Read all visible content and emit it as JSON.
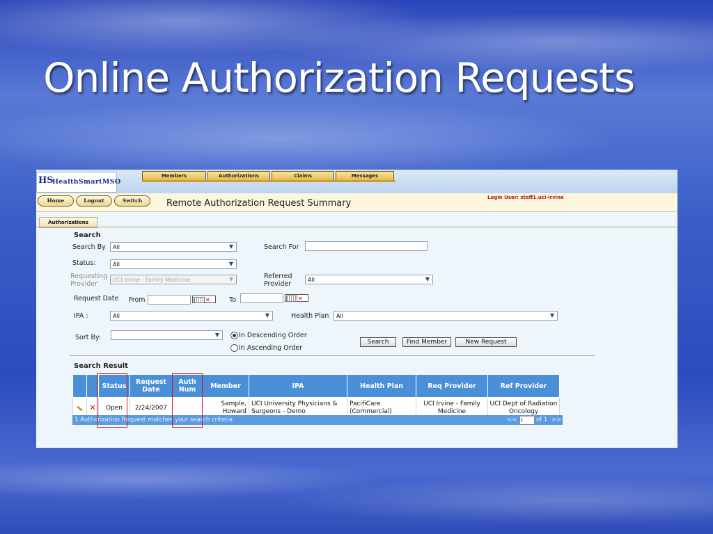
{
  "slide": {
    "title": "Online Authorization Requests"
  },
  "app": {
    "logo_mark": "HS",
    "logo_text": "HealthSmartMSO",
    "nav_tabs": [
      "Members",
      "Authorizations",
      "Claims",
      "Messages"
    ],
    "actions": {
      "home": "Home",
      "logout": "Logout",
      "switch": "Switch"
    },
    "page_title": "Remote Authorization Request Summary",
    "login_user": "Login User: staff1.uci-irvine",
    "subtab": "Authorizations"
  },
  "search": {
    "heading": "Search",
    "search_by_label": "Search By",
    "search_by_value": "All",
    "search_for_label": "Search For",
    "search_for_value": "",
    "status_label": "Status:",
    "status_value": "All",
    "requesting_provider_label_1": "Requesting",
    "requesting_provider_label_2": "Provider",
    "requesting_provider_value": "UCI Irvine - Family Medicine",
    "referred_provider_label_1": "Referred",
    "referred_provider_label_2": "Provider",
    "referred_provider_value": "All",
    "request_date_label": "Request Date",
    "from_label": "From",
    "to_label": "To",
    "from_value": "",
    "to_value": "",
    "ipa_label": "IPA :",
    "ipa_value": "All",
    "health_plan_label": "Health Plan",
    "health_plan_value": "All",
    "sort_by_label": "Sort By:",
    "sort_by_value": "",
    "order_desc": "In Descending Order",
    "order_asc": "In Ascending Order",
    "order_selected": "desc",
    "buttons": {
      "search": "Search",
      "find_member": "Find Member",
      "new_request": "New Request"
    }
  },
  "results": {
    "heading": "Search Result",
    "columns": [
      "Status",
      "Request Date",
      "Auth Num",
      "Member",
      "IPA",
      "Health Plan",
      "Req Provider",
      "Ref Provider"
    ],
    "rows": [
      {
        "status": "Open",
        "request_date": "2/24/2007",
        "auth_num": "",
        "member": "Sample, Howard",
        "ipa": "UCI University Physicians & Surgeons - Demo",
        "health_plan": "PacifiCare (Commercial)",
        "req_provider": "UCI Irvine - Family Medicine",
        "ref_provider": "UCI Dept of Radiation Oncology"
      }
    ],
    "footer_text": "1 Authorization Request matches your search criteria",
    "pager": {
      "prev": "<<",
      "page": "1",
      "of_text": "of 1",
      "next": ">>"
    }
  },
  "icons": {
    "edit": "pencil-icon",
    "delete": "delete-x-icon",
    "calendar": "calendar-icon",
    "clear": "clear-date-icon"
  },
  "colors": {
    "table_header": "#4a90d9",
    "login_text": "#b21e1e",
    "highlight_box": "#d01818"
  }
}
